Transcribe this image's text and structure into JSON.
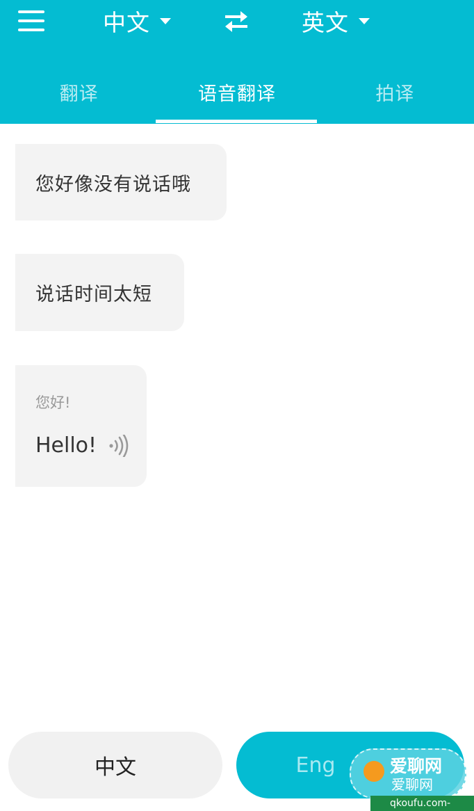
{
  "header": {
    "source_language": "中文",
    "target_language": "英文",
    "tabs": [
      {
        "label": "翻译",
        "active": false
      },
      {
        "label": "语音翻译",
        "active": true
      },
      {
        "label": "拍译",
        "active": false
      }
    ]
  },
  "messages": [
    {
      "text": "您好像没有说话哦"
    },
    {
      "text": "说话时间太短"
    },
    {
      "source": "您好!",
      "result": "Hello!"
    }
  ],
  "bottom": {
    "chinese_button": "中文",
    "english_button": "Eng"
  },
  "watermark": {
    "line1": "爱聊网",
    "line2": "爱聊网",
    "footer": "qkoufu.com-"
  },
  "colors": {
    "primary": "#04bcd2",
    "bubble": "#f3f3f3",
    "text": "#333333",
    "muted": "#999999"
  },
  "icons": [
    "menu-icon",
    "caret-down-icon",
    "swap-icon",
    "speaker-icon"
  ]
}
